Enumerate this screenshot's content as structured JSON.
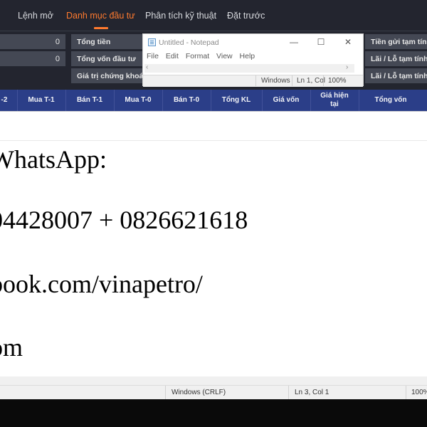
{
  "app": {
    "tabs": [
      {
        "label": "Lệnh mở"
      },
      {
        "label": "Danh mục đầu tư",
        "active": true
      },
      {
        "label": "Phân tích kỹ thuật"
      },
      {
        "label": "Đặt trước"
      }
    ],
    "summary": {
      "left_values": [
        "0",
        "0"
      ],
      "mid_labels": [
        "Tổng tiền",
        "Tổng vốn đầu tư",
        "Giá trị chứng khoán"
      ],
      "right_labels": [
        "Tiền gửi tạm tính",
        "Lãi / Lỗ tạm tính (",
        "Lãi / Lỗ tạm tính ("
      ]
    },
    "columns": [
      "-2",
      "Mua T-1",
      "Bán T-1",
      "Mua T-0",
      "Bán T-0",
      "Tổng KL",
      "Giá vốn",
      "Giá hiện\ntại",
      "Tổng vốn"
    ],
    "colors": {
      "accent": "#ff7a2e",
      "header_row": "#2b3e88",
      "panel": "#23252f"
    }
  },
  "notepad_small": {
    "title": "Untitled - Notepad",
    "controls": {
      "minimize": "—",
      "maximize": "☐",
      "close": "✕"
    },
    "menu": [
      "File",
      "Edit",
      "Format",
      "View",
      "Help"
    ],
    "status": {
      "encoding": "Windows",
      "position": "Ln 1, Col",
      "zoom": "100%"
    }
  },
  "notepad_big": {
    "lines": [
      "WhatsApp:",
      "04428007 + 0826621618",
      "book.com/vinapetro/",
      "om"
    ],
    "status": {
      "encoding": "Windows (CRLF)",
      "position": "Ln 3, Col 1",
      "zoom": "100%"
    }
  }
}
